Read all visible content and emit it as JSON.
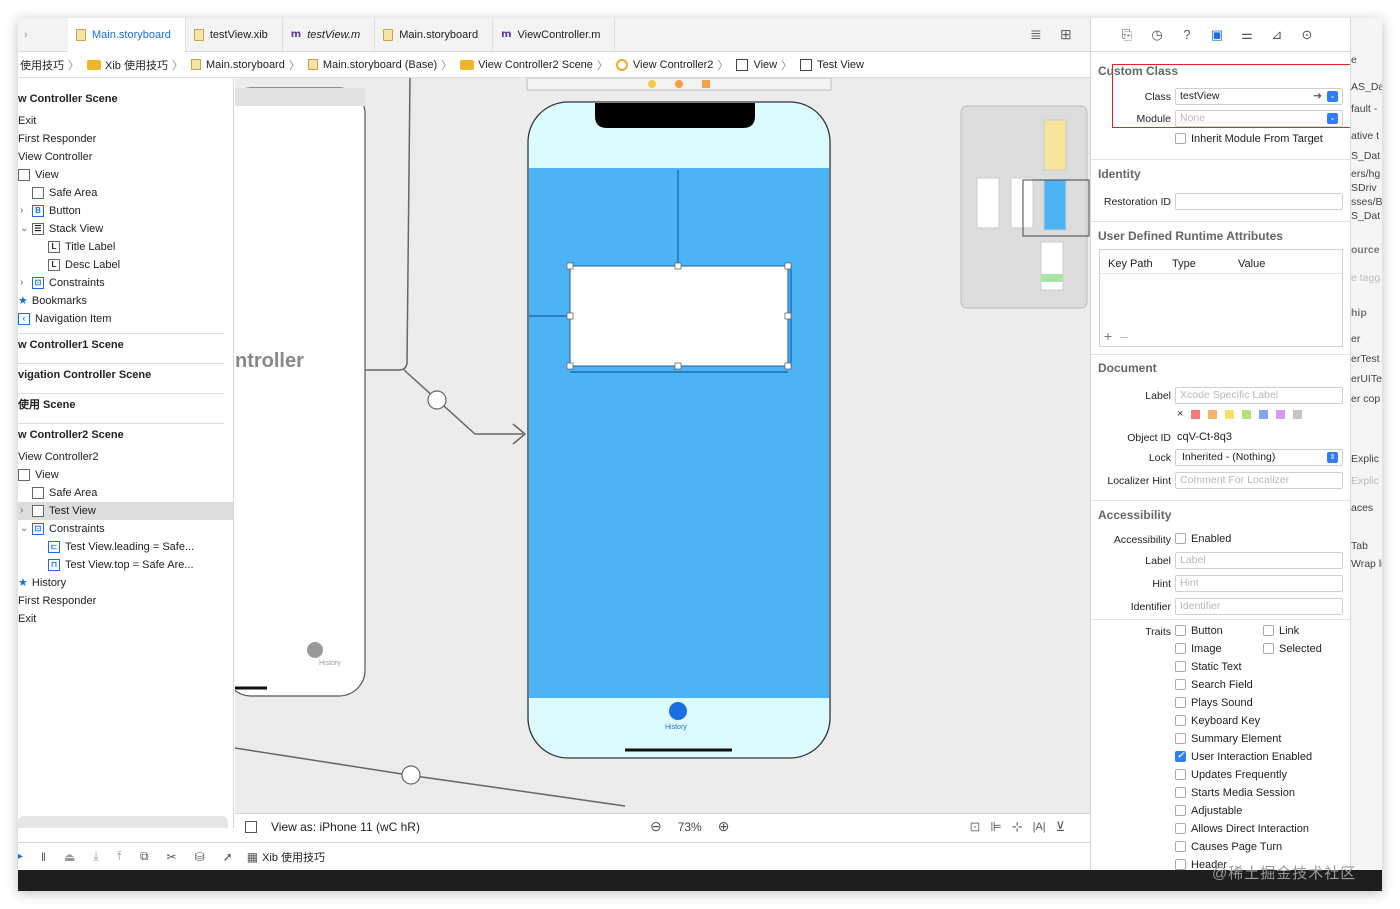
{
  "tabs": [
    {
      "label": "Main.storyboard",
      "kind": "storyboard",
      "active": true
    },
    {
      "label": "testView.xib",
      "kind": "storyboard",
      "active": false
    },
    {
      "label": "testView.m",
      "kind": "m",
      "active": false
    },
    {
      "label": "Main.storyboard",
      "kind": "storyboard",
      "active": false
    },
    {
      "label": "ViewController.m",
      "kind": "m",
      "active": false
    }
  ],
  "breadcrumb": [
    "使用技巧",
    "Xib 使用技巧",
    "Main.storyboard",
    "Main.storyboard (Base)",
    "View Controller2 Scene",
    "View Controller2",
    "View",
    "Test View"
  ],
  "outline": {
    "items": [
      {
        "text": "w Controller Scene",
        "hdr": true
      },
      {
        "text": "Exit"
      },
      {
        "text": "First Responder"
      },
      {
        "text": "View Controller"
      },
      {
        "text": "View"
      },
      {
        "text": "Safe Area"
      },
      {
        "text": "Button"
      },
      {
        "text": "Stack View"
      },
      {
        "text": "Title Label"
      },
      {
        "text": "Desc Label"
      },
      {
        "text": "Constraints"
      },
      {
        "text": "Bookmarks"
      },
      {
        "text": "Navigation Item"
      },
      {
        "text": "w Controller1 Scene",
        "hdr": true
      },
      {
        "text": "vigation Controller Scene",
        "hdr": true
      },
      {
        "text": "使用 Scene",
        "hdr": true
      },
      {
        "text": "w Controller2 Scene",
        "hdr": true
      },
      {
        "text": "View Controller2"
      },
      {
        "text": "View"
      },
      {
        "text": "Safe Area"
      },
      {
        "text": "Test View"
      },
      {
        "text": "Constraints"
      },
      {
        "text": "Test View.leading = Safe..."
      },
      {
        "text": "Test View.top = Safe Are..."
      },
      {
        "text": "History"
      },
      {
        "text": "First Responder"
      },
      {
        "text": "Exit"
      }
    ]
  },
  "canvas": {
    "scene_title_fragment": "ntroller",
    "history_label": "History",
    "history_label_2": "History"
  },
  "bottom_bar": {
    "view_as": "View as: iPhone 11 (wC hR)",
    "zoom": "73%"
  },
  "debug_bar": {
    "target": "Xib 使用技巧"
  },
  "inspector": {
    "custom_class": {
      "title": "Custom Class",
      "class_label": "Class",
      "class_value": "testView",
      "module_label": "Module",
      "module_placeholder": "None",
      "inherit": "Inherit Module From Target"
    },
    "identity": {
      "title": "Identity",
      "restoration_label": "Restoration ID"
    },
    "runtime": {
      "title": "User Defined Runtime Attributes",
      "col_key": "Key Path",
      "col_type": "Type",
      "col_value": "Value"
    },
    "document": {
      "title": "Document",
      "label_label": "Label",
      "label_placeholder": "Xcode Specific Label",
      "object_id_label": "Object ID",
      "object_id": "cqV-Ct-8q3",
      "lock_label": "Lock",
      "lock_value": "Inherited - (Nothing)",
      "hint_label": "Localizer Hint",
      "hint_placeholder": "Comment For Localizer"
    },
    "accessibility": {
      "title": "Accessibility",
      "acc_label": "Accessibility",
      "enabled": "Enabled",
      "label_label": "Label",
      "label_placeholder": "Label",
      "hint_label": "Hint",
      "hint_placeholder": "Hint",
      "identifier_label": "Identifier",
      "identifier_placeholder": "Identifier",
      "traits_label": "Traits",
      "traits": [
        {
          "name": "Button",
          "checked": false
        },
        {
          "name": "Link",
          "checked": false
        },
        {
          "name": "Image",
          "checked": false
        },
        {
          "name": "Selected",
          "checked": false
        },
        {
          "name": "Static Text",
          "checked": false
        },
        {
          "name": "Search Field",
          "checked": false
        },
        {
          "name": "Plays Sound",
          "checked": false
        },
        {
          "name": "Keyboard Key",
          "checked": false
        },
        {
          "name": "Summary Element",
          "checked": false
        },
        {
          "name": "User Interaction Enabled",
          "checked": true
        },
        {
          "name": "Updates Frequently",
          "checked": false
        },
        {
          "name": "Starts Media Session",
          "checked": false
        },
        {
          "name": "Adjustable",
          "checked": false
        },
        {
          "name": "Allows Direct Interaction",
          "checked": false
        },
        {
          "name": "Causes Page Turn",
          "checked": false
        },
        {
          "name": "Header",
          "checked": false
        }
      ]
    }
  },
  "ghost_panel": [
    "e",
    "AS_Da",
    "fault -",
    "ative t",
    "S_Dat",
    "ers/hg",
    "SDriv",
    "sses/B",
    "S_Dat",
    "ource",
    "e tagg",
    "hip",
    "er",
    "erTest",
    "erUITe",
    "er cop",
    "Explic",
    "Explic",
    "aces",
    "Tab",
    "Wrap li"
  ],
  "watermark": "@稀土掘金技术社区",
  "colors": {
    "accent": "#1a6fe0",
    "sky": "#4cb3f5",
    "lightcyan": "#dcfbff",
    "highlight_box": "#e0242b"
  }
}
